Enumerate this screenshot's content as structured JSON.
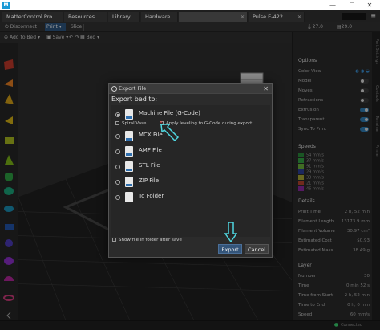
{
  "titlebar": {
    "app_icon": "M",
    "minimize": "—",
    "maximize": "☐",
    "close": "✕"
  },
  "tabs": [
    {
      "label": "MatterControl Pro",
      "close": "",
      "active": false
    },
    {
      "label": "Resources",
      "close": "",
      "active": false
    },
    {
      "label": "Library",
      "close": "",
      "active": false
    },
    {
      "label": "Hardware",
      "close": "",
      "active": false
    },
    {
      "label": "",
      "close": "✕",
      "active": true
    },
    {
      "label": "Pulse E-422",
      "close": "✕",
      "active": false
    }
  ],
  "toolbar": {
    "disconnect": "Disconnect",
    "print": "Print",
    "slice": "Slice",
    "temp1": "27.0",
    "temp2": "29.0"
  },
  "toolbar2": {
    "add_to_bed": "Add to Bed",
    "save": "Save",
    "bed": "Bed"
  },
  "right_panel": {
    "options_header": "Options",
    "rows": [
      {
        "label": "Color View",
        "control": "icons"
      },
      {
        "label": "Model",
        "control": "toggle",
        "on": false
      },
      {
        "label": "Moves",
        "control": "toggle",
        "on": false
      },
      {
        "label": "Retractions",
        "control": "toggle",
        "on": false
      },
      {
        "label": "Extrusion",
        "control": "toggle",
        "on": true
      },
      {
        "label": "Transparent",
        "control": "toggle",
        "on": true
      },
      {
        "label": "Sync To Print",
        "control": "toggle",
        "on": true
      }
    ],
    "speeds_header": "Speeds",
    "speeds": [
      {
        "value": "54 mm/s",
        "color": "#2a8a3a"
      },
      {
        "value": "37 mm/s",
        "color": "#35a345"
      },
      {
        "value": "91 mm/s",
        "color": "#6ab13a"
      },
      {
        "value": "29 mm/s",
        "color": "#2d3f9a"
      },
      {
        "value": "33 mm/s",
        "color": "#a6a634"
      },
      {
        "value": "21 mm/s",
        "color": "#b5452e"
      },
      {
        "value": "46 mm/s",
        "color": "#8a2aa0"
      }
    ],
    "details_header": "Details",
    "details": [
      {
        "label": "Print Time",
        "value": "2 h, 52 min"
      },
      {
        "label": "Filament Length",
        "value": "13173.9 mm"
      },
      {
        "label": "Filament Volume",
        "value": "30.97 cm³"
      },
      {
        "label": "Estimated Cost",
        "value": "$0.93"
      },
      {
        "label": "Estimated Mass",
        "value": "38.49 g"
      }
    ],
    "layer_header": "Layer",
    "layer": [
      {
        "label": "Number",
        "value": "30"
      },
      {
        "label": "Time",
        "value": "0 min 52 s"
      },
      {
        "label": "Time from Start",
        "value": "2 h, 52 min"
      },
      {
        "label": "Time to End",
        "value": "0 h, 0 min"
      },
      {
        "label": "Speed",
        "value": "60 mm/s"
      }
    ]
  },
  "side_tabs": [
    "Part Settings",
    "Controls",
    "Terminal",
    "Printer"
  ],
  "statusbar": {
    "connected": "Connected"
  },
  "dialog": {
    "title": "Export File",
    "close": "✕",
    "heading": "Export bed to:",
    "options": [
      {
        "label": "Machine File (G-Code)",
        "selected": true,
        "icon": "file-icon"
      },
      {
        "label": "MCX File",
        "selected": false,
        "icon": "file-icon"
      },
      {
        "label": "AMF File",
        "selected": false,
        "icon": "file-icon"
      },
      {
        "label": "STL File",
        "selected": false,
        "icon": "file-icon"
      },
      {
        "label": "ZIP File",
        "selected": false,
        "icon": "file-icon"
      },
      {
        "label": "To Folder",
        "selected": false,
        "icon": "folder-icon"
      }
    ],
    "spiral_vase": "Spiral Vase",
    "apply_leveling": "Apply leveling to G-Code during export",
    "show_in_folder": "Show file in folder after save",
    "export_button": "Export",
    "cancel_button": "Cancel"
  },
  "colors": {
    "accent": "#2f7fb7",
    "annotation_arrow": "#4fd6e0"
  }
}
